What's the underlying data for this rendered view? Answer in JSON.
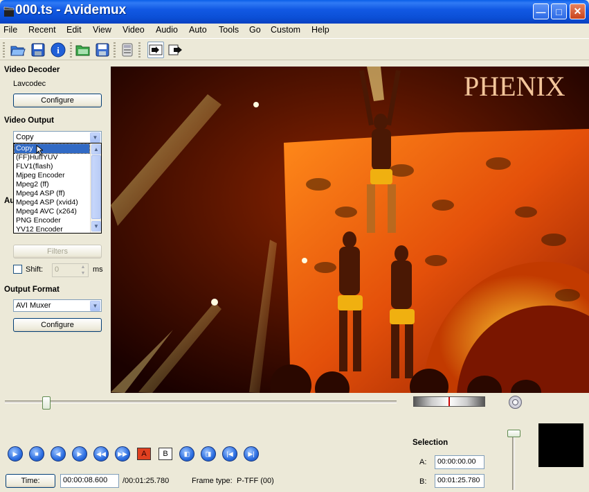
{
  "window": {
    "title": "000.ts - Avidemux",
    "minimize_glyph": "—",
    "maximize_glyph": "□",
    "close_glyph": "✕"
  },
  "menu": [
    {
      "label": "File"
    },
    {
      "label": "Recent"
    },
    {
      "label": "Edit"
    },
    {
      "label": "View"
    },
    {
      "label": "Video"
    },
    {
      "label": "Audio"
    },
    {
      "label": "Auto"
    },
    {
      "label": "Tools"
    },
    {
      "label": "Go"
    },
    {
      "label": "Custom"
    },
    {
      "label": "Help"
    }
  ],
  "toolbar": {
    "buttons": [
      "open-icon",
      "save-icon",
      "info-icon",
      "open-folder-icon",
      "save-video-icon",
      "calculator-icon",
      "input-preview-icon",
      "output-preview-icon"
    ]
  },
  "left_panel": {
    "video_decoder": {
      "title": "Video Decoder",
      "codec": "Lavcodec",
      "configure_label": "Configure"
    },
    "video_output": {
      "title": "Video Output",
      "selected": "Copy",
      "options": [
        "Copy",
        "(FF)HuffYUV",
        "FLV1(flash)",
        "Mjpeg Encoder",
        "Mpeg2 (ff)",
        "Mpeg4 ASP (ff)",
        "Mpeg4 ASP (xvid4)",
        "Mpeg4 AVC (x264)",
        "PNG Encoder",
        "YV12 Encoder"
      ],
      "hidden_section_fragment": "Au",
      "filters_label": "Filters"
    },
    "shift": {
      "label": "Shift:",
      "value": "0",
      "unit": "ms"
    },
    "output_format": {
      "title": "Output Format",
      "selected": "AVI Muxer",
      "configure_label": "Configure"
    }
  },
  "video": {
    "overlay_text": "PHENIX"
  },
  "playback": {
    "ab_a_label": "A",
    "ab_b_label": "B",
    "time_button": "Time:",
    "current_time": "00:00:08.600",
    "total_time": "/00:01:25.780",
    "frame_type_label": "Frame type:",
    "frame_type_value": "P-TFF (00)"
  },
  "selection": {
    "title": "Selection",
    "a_label": "A:",
    "a_value": "00:00:00.00",
    "b_label": "B:",
    "b_value": "00:01:25.780"
  },
  "colors": {
    "titlebar": "#0b4fd6",
    "selected_item": "#316ac5",
    "panel_bg": "#ece9d8"
  }
}
